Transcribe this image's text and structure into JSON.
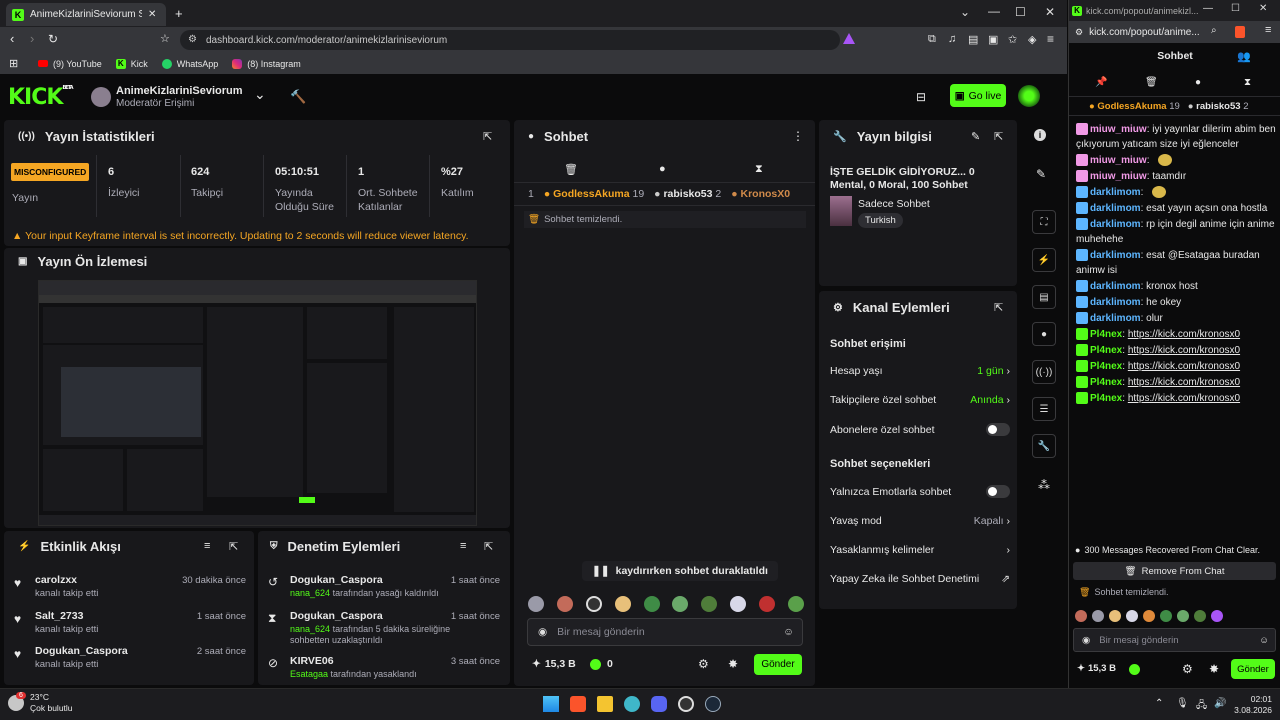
{
  "browser": {
    "tab_title": "AnimeKizlariniSeviorum Stream",
    "url": "dashboard.kick.com/moderator/animekizlariniseviorum",
    "bookmarks": [
      {
        "label": "(9) YouTube",
        "icon": "youtube-icon"
      },
      {
        "label": "Kick",
        "icon": "kick-icon"
      },
      {
        "label": "WhatsApp",
        "icon": "whatsapp-icon"
      },
      {
        "label": "(8) Instagram",
        "icon": "instagram-icon"
      }
    ]
  },
  "popout": {
    "url_short": "kick.com/popout/animekizl...",
    "url_full": "kick.com/popout/anime...",
    "title": "Sohbet"
  },
  "header": {
    "logo": "KICK",
    "logo_sup": "BETA",
    "channel_name": "AnimeKizlariniSeviorum",
    "role": "Moderatör Erişimi",
    "go_live": "Go live"
  },
  "stats": {
    "title": "Yayın İstatistikleri",
    "status_badge": "MISCONFIGURED",
    "status_label": "Yayın",
    "items": [
      {
        "value": "6",
        "label": "İzleyici"
      },
      {
        "value": "624",
        "label": "Takipçi"
      },
      {
        "value": "05:10:51",
        "label": "Yayında Olduğu Süre"
      },
      {
        "value": "1",
        "label": "Ort. Sohbete Katılanlar"
      },
      {
        "value": "%27",
        "label": "Katılım"
      }
    ],
    "warning": "Your input Keyframe interval is set incorrectly. Updating to 2 seconds will reduce viewer latency."
  },
  "preview": {
    "title": "Yayın Ön İzlemesi"
  },
  "activity": {
    "title": "Etkinlik Akışı",
    "items": [
      {
        "user": "carolzxx",
        "desc": "kanalı takip etti",
        "time": "30 dakika önce"
      },
      {
        "user": "Salt_2733",
        "desc": "kanalı takip etti",
        "time": "1 saat önce"
      },
      {
        "user": "Dogukan_Caspora",
        "desc": "kanalı takip etti",
        "time": "2 saat önce"
      }
    ]
  },
  "moderation": {
    "title": "Denetim Eylemleri",
    "items": [
      {
        "user": "Dogukan_Caspora",
        "actor": "nana_624",
        "desc": "tarafından yasağı kaldırıldı",
        "time": "1 saat önce"
      },
      {
        "user": "Dogukan_Caspora",
        "actor": "nana_624",
        "desc": "tarafından 5 dakika süreliğine sohbetten uzaklaştırıldı",
        "time": "1 saat önce"
      },
      {
        "user": "KIRVE06",
        "actor": "Esatagaa",
        "desc": "tarafından yasaklandı",
        "time": "3 saat önce"
      }
    ]
  },
  "chat": {
    "title": "Sohbet",
    "leaders": [
      {
        "rank": "1",
        "name": "GodlessAkuma",
        "count": "19"
      },
      {
        "rank": "",
        "name": "rabisko53",
        "count": "2"
      },
      {
        "rank": "",
        "name": "KronosX0",
        "count": ""
      }
    ],
    "cleared": "Sohbet temizlendi.",
    "paused": "kaydırırken sohbet duraklatıldı",
    "input_placeholder": "Bir mesaj gönderin",
    "points": "15,3 B",
    "kick_count": "0",
    "send": "Gönder"
  },
  "stream_info": {
    "title": "Yayın bilgisi",
    "stream_title": "İŞTE GELDİK GİDİYORUZ... 0 Mental, 0 Moral, 100 Sohbet",
    "category": "Sadece Sohbet",
    "tag": "Turkish"
  },
  "channel_actions": {
    "title": "Kanal Eylemleri",
    "access_title": "Sohbet erişimi",
    "access": [
      {
        "label": "Hesap yaşı",
        "value": "1 gün",
        "kind": "chevron"
      },
      {
        "label": "Takipçilere özel sohbet",
        "value": "Anında",
        "kind": "chevron"
      },
      {
        "label": "Abonelere özel sohbet",
        "value": "",
        "kind": "toggle"
      }
    ],
    "options_title": "Sohbet seçenekleri",
    "options": [
      {
        "label": "Yalnızca Emotlarla sohbet",
        "value": "",
        "kind": "toggle"
      },
      {
        "label": "Yavaş mod",
        "value": "Kapalı",
        "kind": "chevron"
      },
      {
        "label": "Yasaklanmış kelimeler",
        "value": "",
        "kind": "chevron"
      },
      {
        "label": "Yapay Zeka ile Sohbet Denetimi",
        "value": "",
        "kind": "external"
      }
    ]
  },
  "popout_chat": {
    "leaders": [
      {
        "rank": "1",
        "name": "GodlessAkuma",
        "count": "19"
      },
      {
        "rank": "",
        "name": "rabisko53",
        "count": "2"
      }
    ],
    "messages": [
      {
        "user": "miuw_miuw",
        "text": "iyi yayınlar dilerim abim ben çıkıyorum yatıcam size iyi eğlenceler",
        "color": "#f19ae6"
      },
      {
        "user": "miuw_miuw",
        "text": "",
        "color": "#f19ae6"
      },
      {
        "user": "miuw_miuw",
        "text": "taamdır",
        "color": "#f19ae6"
      },
      {
        "user": "darklimom",
        "text": "",
        "color": "#5db6ff"
      },
      {
        "user": "darklimom",
        "text": "esat yayın açsın ona hostla",
        "color": "#5db6ff"
      },
      {
        "user": "darklimom",
        "text": "rp için degil anime için anime muhehehe",
        "color": "#5db6ff"
      },
      {
        "user": "darklimom",
        "text": "esat @Esatagaa buradan animw isi",
        "color": "#5db6ff"
      },
      {
        "user": "darklimom",
        "text": "kronox host",
        "color": "#5db6ff"
      },
      {
        "user": "darklimom",
        "text": "he okey",
        "color": "#5db6ff"
      },
      {
        "user": "darklimom",
        "text": "olur",
        "color": "#5db6ff"
      },
      {
        "user": "Pl4nex",
        "text": "https://kick.com/kronosx0",
        "color": "#53fc18"
      },
      {
        "user": "Pl4nex",
        "text": "https://kick.com/kronosx0",
        "color": "#53fc18"
      },
      {
        "user": "Pl4nex",
        "text": "https://kick.com/kronosx0",
        "color": "#53fc18"
      },
      {
        "user": "Pl4nex",
        "text": "https://kick.com/kronosx0",
        "color": "#53fc18"
      },
      {
        "user": "Pl4nex",
        "text": "https://kick.com/kronosx0",
        "color": "#53fc18"
      }
    ],
    "recovered": "300 Messages Recovered From Chat Clear.",
    "remove": "Remove From Chat",
    "cleared": "Sohbet temizlendi.",
    "input_placeholder": "Bir mesaj gönderin",
    "points": "15,3 B",
    "send": "Gönder"
  },
  "taskbar": {
    "weather_temp": "23°C",
    "weather_desc": "Çok bulutlu",
    "weather_badge": "6",
    "time": "02:01",
    "date": "3.08.2026"
  },
  "colors": {
    "accent": "#53fc18",
    "panel": "#18181b",
    "bg": "#0b0b0c",
    "warning": "#f5a623"
  }
}
